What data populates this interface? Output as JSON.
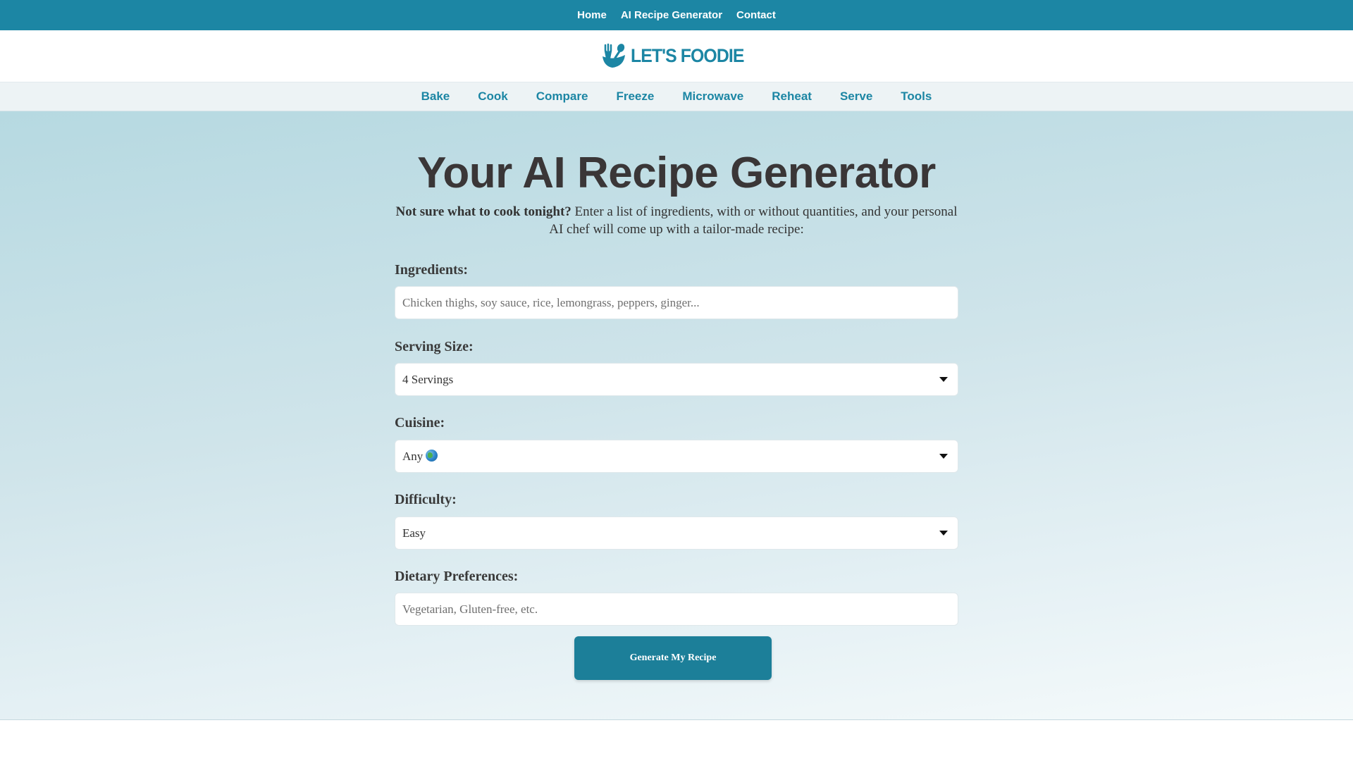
{
  "topnav": {
    "items": [
      "Home",
      "AI Recipe Generator",
      "Contact"
    ]
  },
  "logo": {
    "text": "LET'S FOODIE"
  },
  "category_nav": {
    "items": [
      "Bake",
      "Cook",
      "Compare",
      "Freeze",
      "Microwave",
      "Reheat",
      "Serve",
      "Tools"
    ]
  },
  "hero": {
    "title": "Your AI Recipe Generator",
    "intro_bold": "Not sure what to cook tonight?",
    "intro_text": " Enter a list of ingredients, with or without quantities, and your personal AI chef will come up with a tailor-made recipe:"
  },
  "form": {
    "ingredients": {
      "label": "Ingredients:",
      "placeholder": "Chicken thighs, soy sauce, rice, lemongrass, peppers, ginger...",
      "value": ""
    },
    "serving_size": {
      "label": "Serving Size:",
      "value": "4 Servings"
    },
    "cuisine": {
      "label": "Cuisine:",
      "value": "Any"
    },
    "difficulty": {
      "label": "Difficulty:",
      "value": "Easy"
    },
    "dietary": {
      "label": "Dietary Preferences:",
      "placeholder": "Vegetarian, Gluten-free, etc.",
      "value": ""
    },
    "submit_label": "Generate My Recipe"
  },
  "colors": {
    "brand": "#1c86a4",
    "button": "#1c7f99",
    "title": "#3a3637"
  },
  "icons": [
    "fork-spoon-bowl-logo-icon",
    "globe-icon",
    "chevron-down-icon"
  ]
}
